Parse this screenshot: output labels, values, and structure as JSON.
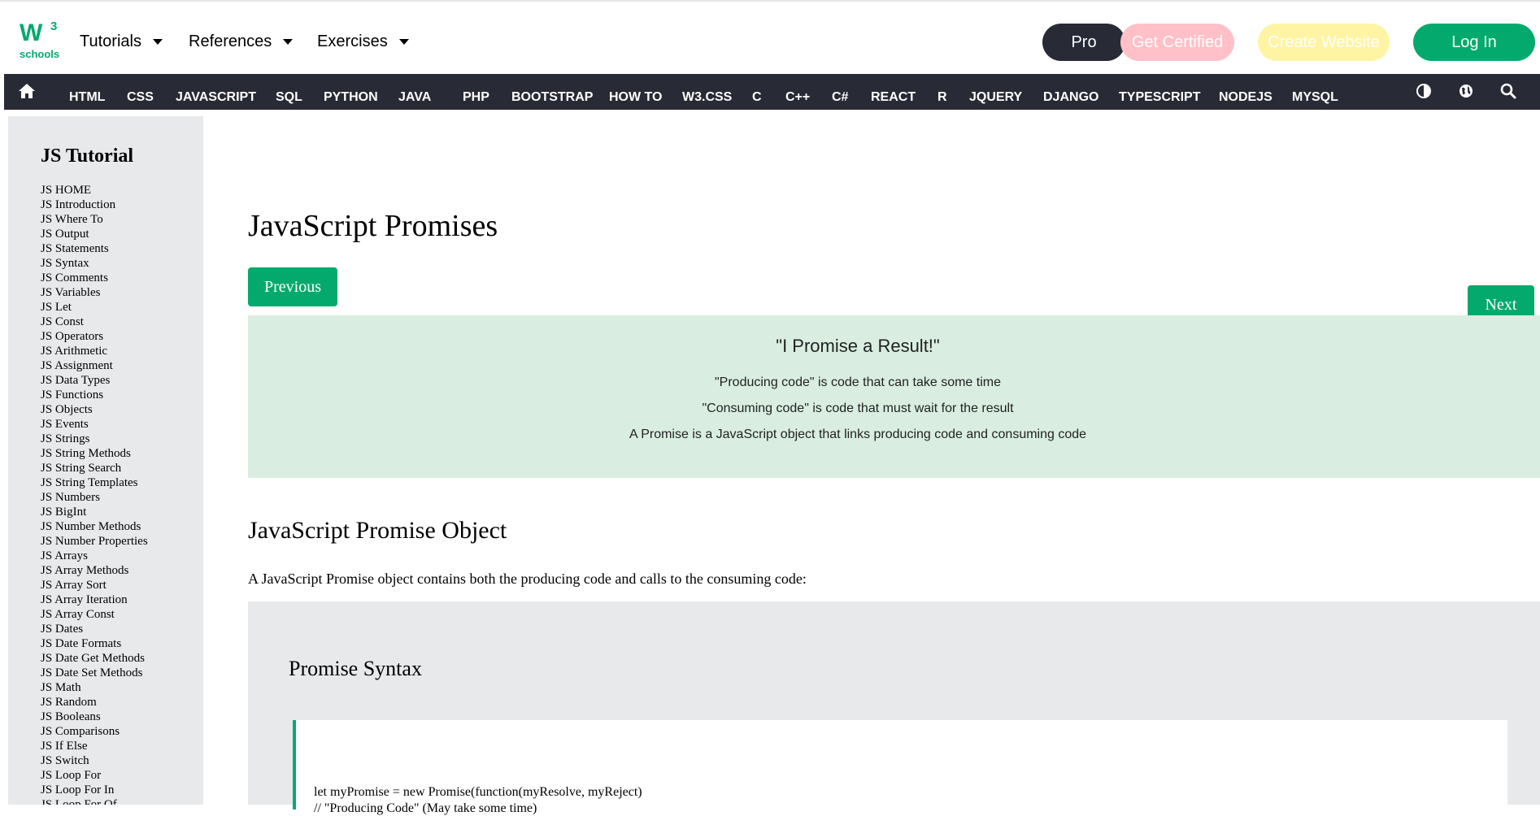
{
  "header": {
    "logo_text": "W",
    "logo_sup": "3",
    "logo_sub": "schools",
    "menu": [
      {
        "label": "Tutorials"
      },
      {
        "label": "References"
      },
      {
        "label": "Exercises"
      }
    ],
    "pro_label": "Pro",
    "certified_label": "Get Certified",
    "create_label": "Create Website",
    "login_label": "Log In"
  },
  "topnav": {
    "items": [
      "HTML",
      "CSS",
      "JAVASCRIPT",
      "SQL",
      "PYTHON",
      "JAVA",
      "PHP",
      "BOOTSTRAP",
      "HOW TO",
      "W3.CSS",
      "C",
      "C++",
      "C#",
      "REACT",
      "R",
      "JQUERY",
      "DJANGO",
      "TYPESCRIPT",
      "NODEJS",
      "MYSQL"
    ]
  },
  "sidebar": {
    "title": "JS Tutorial",
    "items": [
      "JS HOME",
      "JS Introduction",
      "JS Where To",
      "JS Output",
      "JS Statements",
      "JS Syntax",
      "JS Comments",
      "JS Variables",
      "JS Let",
      "JS Const",
      "JS Operators",
      "JS Arithmetic",
      "JS Assignment",
      "JS Data Types",
      "JS Functions",
      "JS Objects",
      "JS Events",
      "JS Strings",
      "JS String Methods",
      "JS String Search",
      "JS String Templates",
      "JS Numbers",
      "JS BigInt",
      "JS Number Methods",
      "JS Number Properties",
      "JS Arrays",
      "JS Array Methods",
      "JS Array Sort",
      "JS Array Iteration",
      "JS Array Const",
      "JS Dates",
      "JS Date Formats",
      "JS Date Get Methods",
      "JS Date Set Methods",
      "JS Math",
      "JS Random",
      "JS Booleans",
      "JS Comparisons",
      "JS If Else",
      "JS Switch",
      "JS Loop For",
      "JS Loop For In",
      "JS Loop For Of"
    ]
  },
  "main": {
    "title": "JavaScript Promises",
    "previous_label": "Previous",
    "next_label": "Next",
    "note": {
      "heading": "\"I Promise a Result!\"",
      "lines": [
        "\"Producing code\" is code that can take some time",
        "\"Consuming code\" is code that must wait for the result",
        "A Promise is a JavaScript object that links producing code and consuming code"
      ]
    },
    "section_title": "JavaScript Promise Object",
    "section_text": "A JavaScript Promise object contains both the producing code and calls to the consuming code:",
    "example": {
      "heading": "Promise Syntax",
      "code_lines": [
        "let myPromise = new Promise(function(myResolve, myReject)",
        "// \"Producing Code\" (May take some time)"
      ]
    }
  },
  "colors": {
    "brand_green": "#04aa6d",
    "dark_nav": "#282a35",
    "pro_bg": "#282a35",
    "certified_bg": "#ffc0c7",
    "create_bg": "#fff4a3",
    "note_bg": "#d9eee1",
    "sidebar_bg": "#e7e9eb"
  },
  "icons": [
    "home-icon",
    "contrast-icon",
    "globe-icon",
    "search-icon",
    "chevron-down-icon"
  ]
}
